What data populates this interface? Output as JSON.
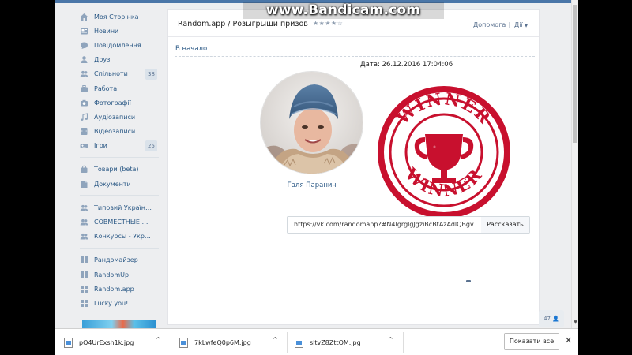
{
  "watermark": "www.Bandicam.com",
  "sidebar": {
    "groups": [
      [
        {
          "label": "Моя Сторінка",
          "icon": "home-icon"
        },
        {
          "label": "Новини",
          "icon": "news-icon"
        },
        {
          "label": "Повідомлення",
          "icon": "message-icon"
        },
        {
          "label": "Друзі",
          "icon": "user-icon"
        },
        {
          "label": "Спільноти",
          "icon": "users-icon",
          "count": "38"
        },
        {
          "label": "Работа",
          "icon": "briefcase-icon"
        },
        {
          "label": "Фотографії",
          "icon": "camera-icon"
        },
        {
          "label": "Аудіозаписи",
          "icon": "music-icon"
        },
        {
          "label": "Відеозаписи",
          "icon": "video-icon"
        },
        {
          "label": "Ігри",
          "icon": "gamepad-icon",
          "count": "25"
        }
      ],
      [
        {
          "label": "Товари (beta)",
          "icon": "bag-icon"
        },
        {
          "label": "Документи",
          "icon": "document-icon"
        }
      ],
      [
        {
          "label": "Типовий Українець",
          "icon": "users-icon"
        },
        {
          "label": "СОВМЕСТНЫЕ ПО...",
          "icon": "users-icon"
        },
        {
          "label": "Конкурсы - Украина",
          "icon": "users-icon"
        }
      ],
      [
        {
          "label": "Рандомайзер",
          "icon": "app-grid-icon"
        },
        {
          "label": "RandomUp",
          "icon": "app-grid-icon"
        },
        {
          "label": "Random.app",
          "icon": "app-grid-icon"
        },
        {
          "label": "Lucky you!",
          "icon": "app-grid-icon"
        }
      ]
    ]
  },
  "header": {
    "title": "Random.app / Розыгрыши призов",
    "stars": "★★★★☆",
    "help": "Допомога",
    "actions": "Дії"
  },
  "main": {
    "start_link": "В начало",
    "date": "Дата: 26.12.2016 17:04:06",
    "winner_name": "Галя Паранич",
    "link_value": "https://vk.com/randomapp?#N4IgrglgJgziBcBtAzAdlQBgv",
    "share_label": "Рассказать",
    "stamp_text": "WINNER"
  },
  "online_count": "47",
  "downloads": {
    "items": [
      {
        "name": "pO4UrExsh1k.jpg"
      },
      {
        "name": "7kLwfeQ0p6M.jpg"
      },
      {
        "name": "sltvZ8ZttOM.jpg"
      }
    ],
    "show_all": "Показати все",
    "close": "✕"
  },
  "colors": {
    "vk_blue": "#4a76a8",
    "link": "#2a5885",
    "stamp_red": "#c8102e"
  }
}
